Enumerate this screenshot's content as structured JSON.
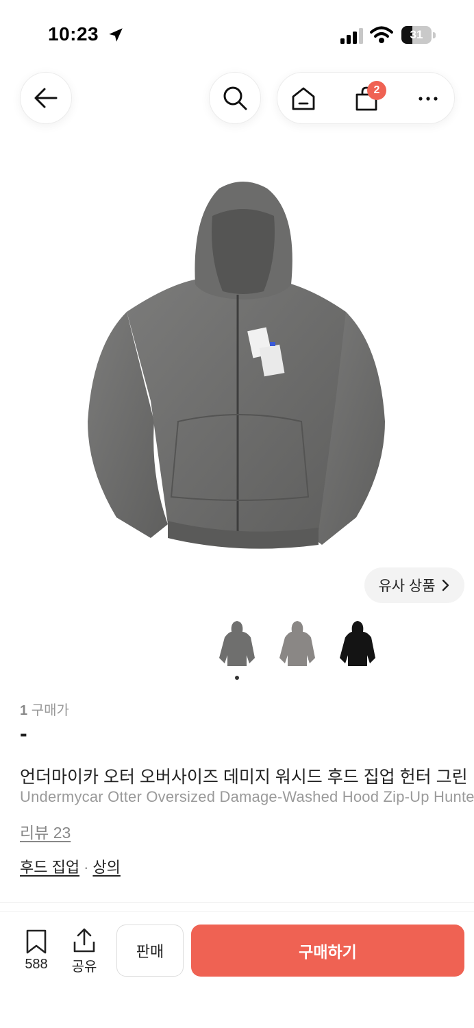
{
  "status_bar": {
    "time": "10:23",
    "battery_level": "31"
  },
  "nav": {
    "cart_count": "2"
  },
  "similar_products_label": "유사 상품",
  "product": {
    "purchase_count_number": "1",
    "purchase_count_label": "구매가",
    "price": "-",
    "title_ko": "언더마이카 오터 오버사이즈 데미지 워시드 후드 집업 헌터 그린",
    "title_en": "Undermycar Otter Oversized Damage-Washed Hood Zip-Up Hunter Green",
    "review_label": "리뷰 23",
    "category_primary": "후드 집업",
    "category_separator": "·",
    "category_secondary": "상의"
  },
  "thumbnails": [
    {
      "color": "#6f6f6e"
    },
    {
      "color": "#8a8785"
    },
    {
      "color": "#141414"
    }
  ],
  "bottom_bar": {
    "bookmark_count": "588",
    "share_label": "공유",
    "sell_label": "판매",
    "buy_label": "구매하기"
  },
  "colors": {
    "accent": "#ef6253",
    "text_primary": "#222222",
    "text_secondary": "#999999"
  }
}
